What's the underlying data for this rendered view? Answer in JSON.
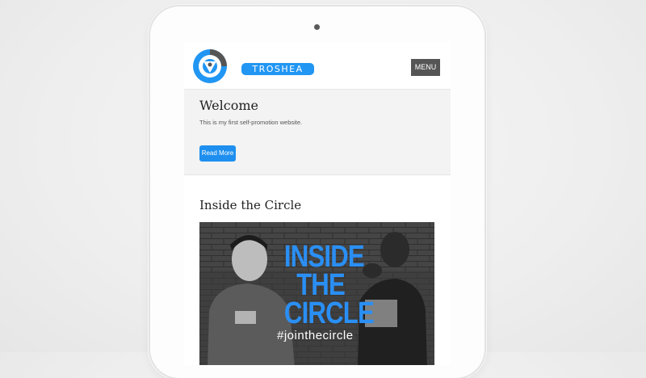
{
  "colors": {
    "accent": "#2196f3",
    "button": "#1e8fef",
    "menu_bg": "#555555",
    "headline_blue": "#2a8ff4"
  },
  "header": {
    "logo_icon": "troshea-logo-icon",
    "brand_name": "TROSHEA",
    "menu_label": "MENU"
  },
  "hero": {
    "title": "Welcome",
    "text": "This is my first self-promotion website.",
    "button_label": "Read More"
  },
  "section": {
    "title": "Inside the Circle",
    "image": {
      "headline": [
        "INSIDE",
        "THE",
        "CIRCLE"
      ],
      "hashtag": "#jointhecircle"
    }
  }
}
